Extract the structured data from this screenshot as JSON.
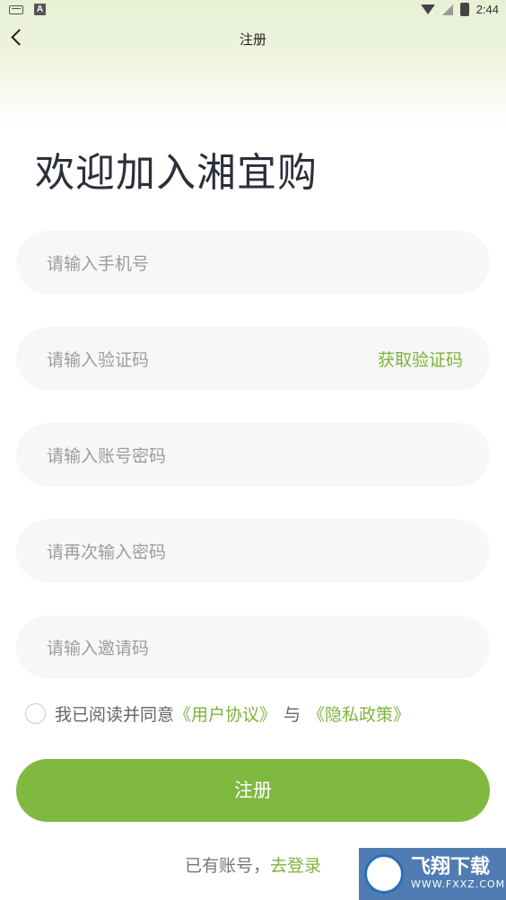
{
  "status_bar": {
    "keyboard_icon": "keyboard-icon",
    "a_badge": "A",
    "time": "2:44"
  },
  "nav": {
    "title": "注册"
  },
  "welcome": "欢迎加入湘宜购",
  "form": {
    "phone_placeholder": "请输入手机号",
    "code_placeholder": "请输入验证码",
    "get_code": "获取验证码",
    "password_placeholder": "请输入账号密码",
    "password_confirm_placeholder": "请再次输入密码",
    "invite_placeholder": "请输入邀请码"
  },
  "agreement": {
    "prefix": "我已阅读并同意",
    "user_agreement": "《用户协议》",
    "separator": "与",
    "privacy_policy": "《隐私政策》"
  },
  "submit_label": "注册",
  "login_prompt": {
    "question": "已有账号，",
    "link": "去登录"
  },
  "watermark": {
    "title": "飞翔下载",
    "domain": "WWW.FXXZ.COM"
  },
  "colors": {
    "accent": "#80b940",
    "link": "#7db43a",
    "field_bg": "#f7f7f7"
  }
}
